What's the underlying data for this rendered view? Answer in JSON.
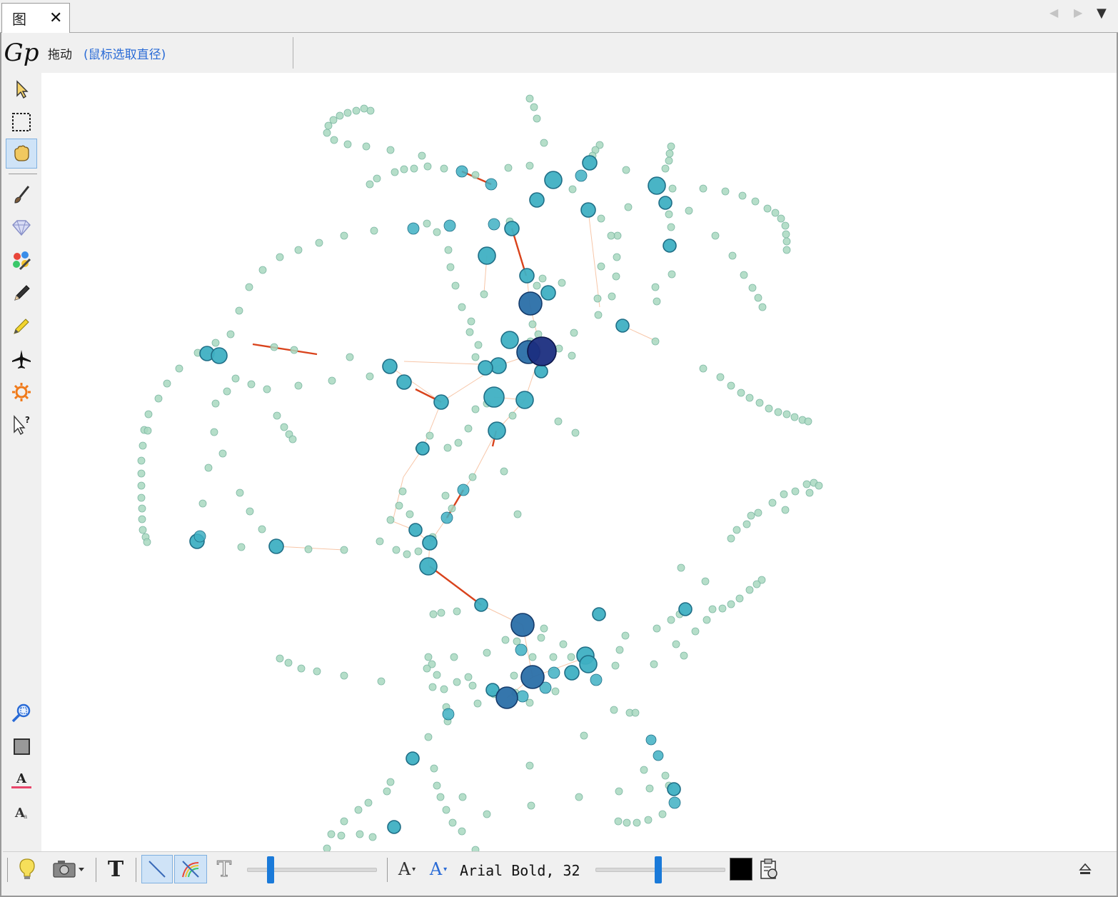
{
  "tab": {
    "label": "图",
    "close_glyph": "✕"
  },
  "tab_nav": {
    "prev_glyph": "◀",
    "next_glyph": "▶",
    "menu_glyph": "▼"
  },
  "topbar": {
    "logo_text": "Gp",
    "mode_label": "拖动",
    "mode_hint": "(鼠标选取直径)"
  },
  "left_tools": [
    {
      "name": "select-arrow-icon"
    },
    {
      "name": "rect-select-icon"
    },
    {
      "name": "drag-hand-icon",
      "active": true
    },
    {
      "name": "paintbrush-icon"
    },
    {
      "name": "diamond-icon"
    },
    {
      "name": "color-palette-icon"
    },
    {
      "name": "pencil-icon"
    },
    {
      "name": "yellow-pencil-icon"
    },
    {
      "name": "airplane-icon"
    },
    {
      "name": "sun-icon"
    },
    {
      "name": "help-cursor-icon"
    },
    {
      "name": "zoom-icon"
    },
    {
      "name": "background-color-icon"
    },
    {
      "name": "label-color-icon"
    },
    {
      "name": "label-size-icon"
    }
  ],
  "bottom_bar": {
    "font_label": "Arial Bold, 32",
    "font_color": "#000000",
    "text_glyph": "T",
    "font_a_glyph": "A"
  },
  "colors": {
    "small_node": "#a8d8c0",
    "mid_node": "#3fb0c3",
    "large_node": "#2a6fa8",
    "hub_node": "#1b2e80",
    "edge_light": "#f7c6a8",
    "edge_strong": "#d9431c",
    "accent": "#1a7ad9"
  }
}
